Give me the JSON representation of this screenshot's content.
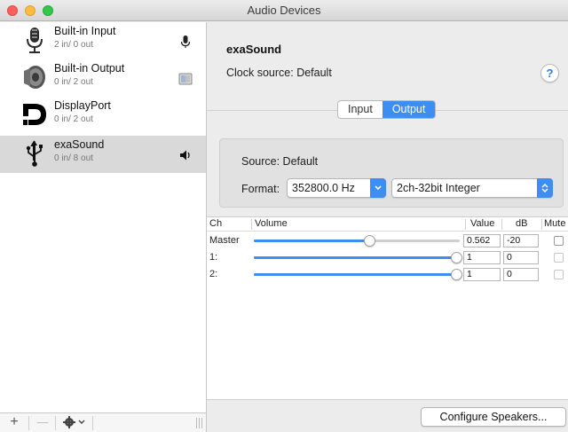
{
  "window": {
    "title": "Audio Devices"
  },
  "devices": [
    {
      "name": "Built-in Input",
      "io": "2 in/ 0 out",
      "icon": "microphone-icon",
      "badge": "microphone-badge-icon"
    },
    {
      "name": "Built-in Output",
      "io": "0 in/ 2 out",
      "icon": "speaker-icon",
      "badge": "finder-badge-icon"
    },
    {
      "name": "DisplayPort",
      "io": "0 in/ 2 out",
      "icon": "displayport-icon",
      "badge": ""
    },
    {
      "name": "exaSound",
      "io": "0 in/ 8 out",
      "icon": "usb-icon",
      "badge": "volume-badge-icon",
      "selected": true
    }
  ],
  "sidebar_footer": {
    "add": "+",
    "remove": "—"
  },
  "detail": {
    "device_name": "exaSound",
    "clock_source": "Clock source:  Default",
    "help": "?",
    "tabs": [
      {
        "label": "Input",
        "active": false
      },
      {
        "label": "Output",
        "active": true
      }
    ],
    "source": "Source:  Default",
    "format_label": "Format:",
    "format_rate": "352800.0 Hz",
    "format_type": "2ch-32bit Integer"
  },
  "table": {
    "headers": {
      "ch": "Ch",
      "volume": "Volume",
      "value": "Value",
      "db": "dB",
      "mute": "Mute"
    },
    "rows": [
      {
        "ch": "Master",
        "level": 0.562,
        "value": "0.562",
        "db": "-20",
        "muted": false
      },
      {
        "ch": "1:",
        "level": 1.0,
        "value": "1",
        "db": "0",
        "muted": false
      },
      {
        "ch": "2:",
        "level": 1.0,
        "value": "1",
        "db": "0",
        "muted": false
      }
    ]
  },
  "buttons": {
    "configure": "Configure Speakers..."
  },
  "colors": {
    "accent": "#3e8df0",
    "selection": "#d9d9d9"
  }
}
